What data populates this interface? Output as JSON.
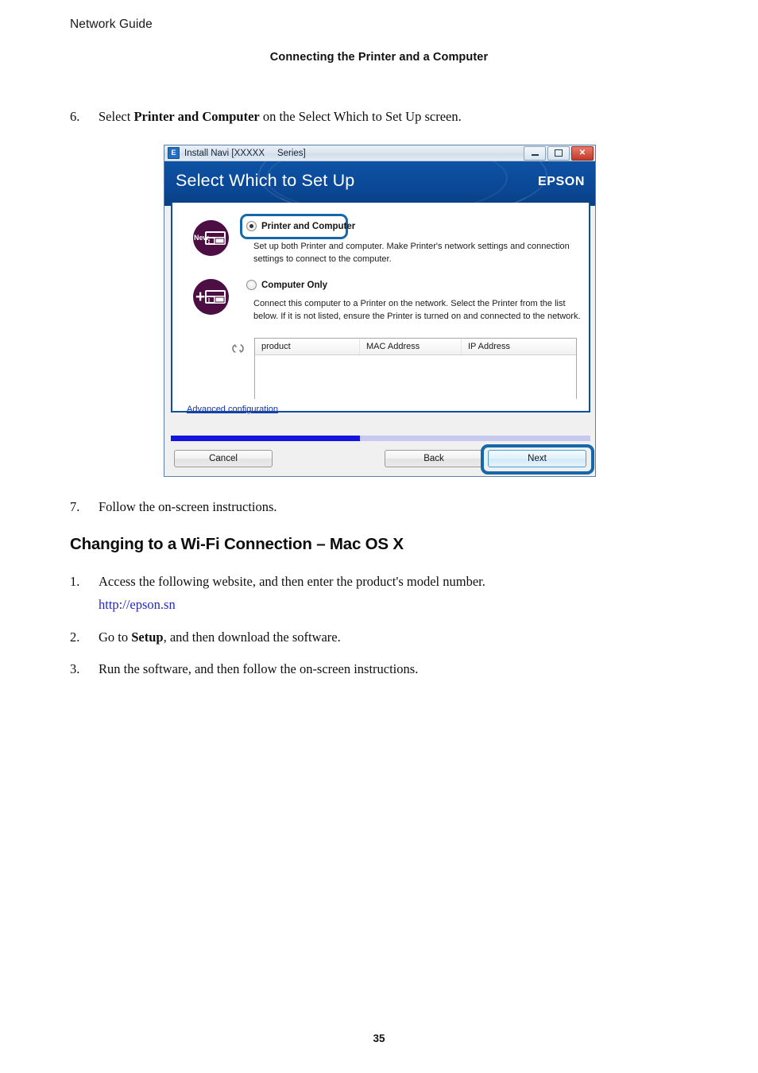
{
  "page": {
    "header_left": "Network Guide",
    "header_center": "Connecting the Printer and a Computer",
    "page_number": "35"
  },
  "steps": {
    "step6": {
      "num": "6.",
      "text_before": "Select ",
      "bold": "Printer and Computer",
      "text_after": " on the Select Which to Set Up screen."
    },
    "step7": {
      "num": "7.",
      "text": "Follow the on-screen instructions."
    }
  },
  "section": {
    "title": "Changing to a Wi-Fi Connection – Mac OS X",
    "items": [
      {
        "num": "1.",
        "text": "Access the following website, and then enter the product's model number.",
        "link": "http://epson.sn"
      },
      {
        "num": "2.",
        "text_before": "Go to ",
        "bold": "Setup",
        "text_after": ", and then download the software."
      },
      {
        "num": "3.",
        "text": "Run the software, and then follow the on-screen instructions."
      }
    ]
  },
  "dialog": {
    "titlebar": {
      "app_icon_letter": "E",
      "title": "Install Navi [XXXXX     Series]",
      "minimize_label": "Minimize",
      "maximize_label": "Maximize",
      "close_label": "✕"
    },
    "banner": {
      "title": "Select Which to Set Up",
      "brand": "EPSON"
    },
    "options": [
      {
        "id": "printer-and-computer",
        "label": "Printer and Computer",
        "selected": true,
        "badge": "New",
        "description": "Set up both Printer and computer. Make Printer's network settings and connection settings to connect to the computer."
      },
      {
        "id": "computer-only",
        "label": "Computer Only",
        "selected": false,
        "badge": "+",
        "description": "Connect this computer to a Printer on the network. Select the Printer from the list below. If it is not listed, ensure the Printer is turned on and connected to the network."
      }
    ],
    "printer_list": {
      "columns": [
        "product",
        "MAC Address",
        "IP Address"
      ],
      "rows": []
    },
    "advanced_link": "Advanced configuration",
    "progress_percent": 45,
    "buttons": {
      "cancel": "Cancel",
      "back": "Back",
      "next": "Next"
    },
    "colors": {
      "banner_blue": "#0b4896",
      "highlight_blue": "#1668a8",
      "progress_blue": "#1414e0",
      "icon_purple": "#4d0e44",
      "link_blue": "#1230a8"
    }
  }
}
